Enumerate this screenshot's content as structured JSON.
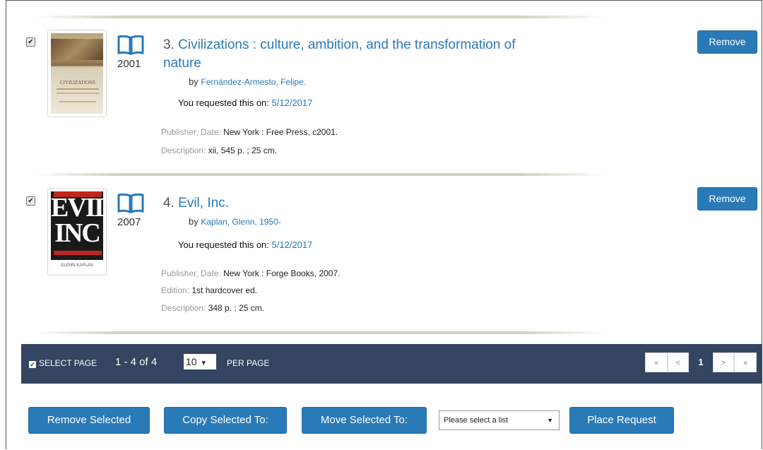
{
  "items": [
    {
      "checked": "✔",
      "year": "2001",
      "number": "3.",
      "title_line1": "Civilizations : culture, ambition, and the transformation of",
      "title_line2": "nature",
      "by_prefix": "by",
      "author": "Fernández-Armesto, Felipe.",
      "requested_label": "You requested this on:",
      "requested_date": "5/12/2017",
      "publisher_label": "Publisher, Date:",
      "publisher": "New York : Free Press, c2001.",
      "description_label": "Description:",
      "description": "xii, 545 p. ; 25 cm.",
      "remove_label": "Remove",
      "cover_text": "CIVILIZATIONS"
    },
    {
      "checked": "✔",
      "year": "2007",
      "number": "4.",
      "title_line1": "Evil, Inc.",
      "by_prefix": "by",
      "author": "Kaplan, Glenn, 1950-",
      "requested_label": "You requested this on:",
      "requested_date": "5/12/2017",
      "publisher_label": "Publisher, Date:",
      "publisher": "New York : Forge Books, 2007.",
      "edition_label": "Edition:",
      "edition": "1st hardcover ed.",
      "description_label": "Description:",
      "description": "348 p. ; 25 cm.",
      "remove_label": "Remove",
      "cover_text_1": "EVIL",
      "cover_text_2": "INC",
      "cover_author": "GLENN KAPLAN"
    }
  ],
  "bar": {
    "select_page_label": "SELECT PAGE",
    "select_checkbox": "✔",
    "range": "1 - 4 of 4",
    "per_page_value": "10",
    "per_page_caret": "▾",
    "per_page_label": "PER PAGE",
    "pager": {
      "first": "«",
      "prev": "<",
      "current": "1",
      "next": ">",
      "last": "»"
    }
  },
  "actions": {
    "remove_selected": "Remove Selected",
    "copy_selected": "Copy Selected To:",
    "move_selected": "Move Selected To:",
    "list_placeholder": "Please select a list",
    "list_caret": "▼",
    "place_request": "Place Request"
  },
  "colors": {
    "accent": "#2a7ab8",
    "bar": "#334560"
  }
}
